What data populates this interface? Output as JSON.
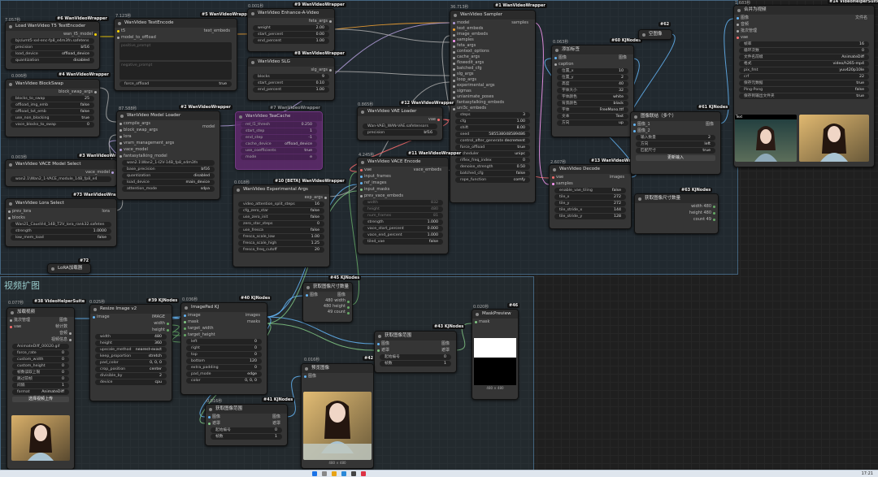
{
  "groups": {
    "main_title": "",
    "expand_title": "视频扩图"
  },
  "colors": {
    "clip": "#ffd500",
    "model": "#b39ddb",
    "image": "#64b5f6",
    "mask": "#81c784",
    "latent": "#ff9cf9",
    "vae": "#ff6e6e",
    "conditioning": "#ffa931"
  },
  "nodes": {
    "t5": {
      "id": "#6 WanVideoWrapper",
      "time": "7.057秒",
      "title": "Load WanVideo T5 TextEncoder",
      "out": "wan_t5_model",
      "widgets": [
        [
          "",
          "bjs/umt5-xxl-enc-fp8_e4m3fn.safetens"
        ],
        [
          "precision",
          "bf16"
        ],
        [
          "load_device",
          "offload_device"
        ],
        [
          "quantization",
          "disabled"
        ]
      ]
    },
    "blockswap": {
      "id": "#4 WanVideoWrapper",
      "time": "0.006秒",
      "title": "WanVideo BlockSwap",
      "out": "block_swap_args",
      "widgets": [
        [
          "blocks_to_swap",
          "25"
        ],
        [
          "offload_img_emb",
          "false"
        ],
        [
          "offload_txt_emb",
          "false"
        ],
        [
          "use_non_blocking",
          "true"
        ],
        [
          "vace_blocks_to_swap",
          "0"
        ]
      ]
    },
    "textencode": {
      "id": "#5 WanVideoWrapper",
      "time": "7.123秒",
      "title": "WanVideo TextEncode",
      "in1": "t5",
      "in2": "model_to_offload",
      "out": "text_embeds",
      "pos": "positive_prompt",
      "neg": "negative_prompt",
      "toggle": [
        "force_offload",
        "true"
      ]
    },
    "model": {
      "id": "#2 WanVideoWrapper",
      "time": "87.588秒",
      "title": "WanVideo Model Loader",
      "out": "model",
      "inputs": [
        "compile_args",
        "block_swap_args",
        "lora",
        "vram_management_args",
        "vace_model",
        "fantasytalking_model"
      ],
      "widgets": [
        [
          "",
          "wan2.1\\Wan2_1-I2V-14B_fp8_e4m3fn"
        ],
        [
          "base_precision",
          "bf16"
        ],
        [
          "quantization",
          "disabled"
        ],
        [
          "load_device",
          "main_device"
        ],
        [
          "attention_mode",
          "sdpa"
        ]
      ]
    },
    "vacemodel": {
      "id": "#3 WanVideoWrapper",
      "time": "0.003秒",
      "title": "WanVideo VACE Model Select",
      "out": "vace_model",
      "widgets": [
        [
          "",
          "wan2.1\\Wan2_1-VACE_module_14B_fp8_e4"
        ]
      ]
    },
    "lora": {
      "id": "#73 WanVideoWrapper",
      "time": "",
      "title": "WanVideo Lora Select",
      "inputs": [
        "prev_lora",
        "blocks"
      ],
      "out": "lora",
      "widgets": [
        [
          "",
          "Wan21_CausVid_14B_T2V_lora_rank32.safeten"
        ],
        [
          "strength",
          "1.0000"
        ],
        [
          "low_mem_load",
          "false"
        ]
      ]
    },
    "enhance": {
      "id": "#9 WanVideoWrapper",
      "time": "0.001秒",
      "title": "WanVideo Enhance-A-Video",
      "out": "feta_args",
      "widgets": [
        [
          "weight",
          "2.00"
        ],
        [
          "start_percent",
          "0.00"
        ],
        [
          "end_percent",
          "1.00"
        ]
      ]
    },
    "slg": {
      "id": "#8 WanVideoWrapper",
      "time": "",
      "title": "WanVideo SLG",
      "out": "slg_args",
      "widgets": [
        [
          "blocks",
          "9"
        ],
        [
          "start_percent",
          "0.10"
        ],
        [
          "end_percent",
          "1.00"
        ]
      ]
    },
    "teacache": {
      "id": "#7 WanVideoWrapper",
      "title": "WanVideo TeaCache",
      "widgets": [
        [
          "rel_l1_thresh",
          "0.250"
        ],
        [
          "start_step",
          "1"
        ],
        [
          "end_step",
          "-1"
        ],
        [
          "cache_device",
          "offload_device"
        ],
        [
          "use_coefficients",
          "true"
        ],
        [
          "mode",
          "e"
        ]
      ]
    },
    "exp": {
      "id": "#10 [BETA] WanVideoWrapper",
      "time": "0.018秒",
      "title": "WanVideo Experimental Args",
      "out": "exp_args",
      "widgets": [
        [
          "video_attention_split_steps",
          "16"
        ],
        [
          "cfg_zero_star",
          "false"
        ],
        [
          "use_zero_init",
          "false"
        ],
        [
          "zero_star_steps",
          "0"
        ],
        [
          "use_fresca",
          "false"
        ],
        [
          "fresca_scale_low",
          "1.00"
        ],
        [
          "fresca_scale_high",
          "1.25"
        ],
        [
          "fresca_freq_cutoff",
          "20"
        ]
      ]
    },
    "sampler": {
      "id": "#1 WanVideoWrapper",
      "time": "36.713秒",
      "title": "WanVideo Sampler",
      "out": "samples",
      "inputs": [
        "model",
        "text_embeds",
        "image_embeds",
        "samples",
        "feta_args",
        "context_options",
        "cache_args",
        "flowedit_args",
        "batched_cfg",
        "slg_args",
        "loop_args",
        "experimental_args",
        "sigmas",
        "unianimate_poses",
        "fantasytalking_embeds",
        "uni3c_embeds"
      ],
      "widgets": [
        [
          "steps",
          "3"
        ],
        [
          "cfg",
          "1.00"
        ],
        [
          "shift",
          "8.00"
        ],
        [
          "seed",
          "585538048589486"
        ],
        [
          "control_after_generate",
          "decrement"
        ],
        [
          "force_offload",
          "true"
        ],
        [
          "scheduler",
          "unipc"
        ],
        [
          "riflex_freq_index",
          "0"
        ],
        [
          "denoise_strength",
          "0.50"
        ],
        [
          "batched_cfg",
          "false"
        ],
        [
          "rope_function",
          "comfy"
        ]
      ]
    },
    "vae": {
      "id": "#12 WanVideoWrapper",
      "time": "0.865秒",
      "title": "WanVideo VAE Loader",
      "out": "vae",
      "widgets": [
        [
          "",
          "Wan-VAE\\_WAN-VAE.safetensors"
        ],
        [
          "precision",
          "bf16"
        ]
      ]
    },
    "vace": {
      "id": "#11 WanVideoWrapper",
      "time": "4.245秒",
      "title": "WanVideo VACE Encode",
      "out": "vace_embeds",
      "inputs": [
        "vae",
        "input_frames",
        "ref_images",
        "input_masks",
        "prev_vace_embeds"
      ],
      "widgets": [
        [
          "width",
          "832"
        ],
        [
          "height",
          "480"
        ],
        [
          "num_frames",
          "81"
        ],
        [
          "strength",
          "1.000"
        ],
        [
          "vace_start_percent",
          "0.000"
        ],
        [
          "vace_end_percent",
          "1.000"
        ],
        [
          "tiled_vae",
          "false"
        ]
      ]
    },
    "decode": {
      "id": "#13 WanVideoWrapper",
      "time": "2.607秒",
      "title": "WanVideo Decode",
      "inputs": [
        "vae",
        "samples"
      ],
      "out": "images",
      "widgets": [
        [
          "enable_vae_tiling",
          "false"
        ],
        [
          "tile_x",
          "272"
        ],
        [
          "tile_y",
          "272"
        ],
        [
          "tile_stride_x",
          "144"
        ],
        [
          "tile_stride_y",
          "128"
        ]
      ]
    },
    "addlabel": {
      "id": "#60 KJNodes",
      "time": "0.063秒",
      "title": "添加标签",
      "inputs": [
        "图像"
      ],
      "in_extra": "caption",
      "out": "图像",
      "widgets": [
        [
          "位置_x",
          "10"
        ],
        [
          "位置_y",
          "2"
        ],
        [
          "高度",
          "40"
        ],
        [
          "字体大小",
          "32"
        ],
        [
          "字体颜色",
          "white"
        ],
        [
          "背景颜色",
          "black"
        ],
        [
          "字体",
          "FreeMono.ttf"
        ],
        [
          "文本",
          "Text"
        ],
        [
          "方向",
          "up"
        ]
      ]
    },
    "emptyimg": {
      "id": "#62",
      "title": "空图像"
    },
    "concat": {
      "id": "#61 KJNodes",
      "title": "图像联结（多个）",
      "inputs": [
        "图像_1",
        "图像_2"
      ],
      "out": "图像",
      "widgets": [
        [
          "输入数量",
          "2"
        ],
        [
          "方向",
          "left"
        ],
        [
          "匹配尺寸",
          "true"
        ]
      ],
      "btn": "更新输入"
    },
    "getsize": {
      "id": "#63 KJNodes",
      "title": "获取图像尺寸数量",
      "outs": [
        [
          "width",
          "480"
        ],
        [
          "height",
          "480"
        ],
        [
          "count",
          "49"
        ]
      ]
    },
    "combine": {
      "id": "#14 VideoHelperSuite",
      "time": "1.683秒",
      "title": "合并为视频",
      "out": "文件名",
      "inputs": [
        "图像",
        "音频",
        "批次管理",
        "vae"
      ],
      "widgets": [
        [
          "帧率",
          "16"
        ],
        [
          "循环次数",
          "0"
        ],
        [
          "文件名前缀",
          "AnimateDiff"
        ],
        [
          "格式",
          "video/h265-mp4"
        ],
        [
          "pix_fmt",
          "yuv420p10le"
        ],
        [
          "crf",
          "22"
        ],
        [
          "保存元数据",
          "true"
        ],
        [
          "Ping-Pong",
          "false"
        ],
        [
          "保存到输出文件夹",
          "true"
        ]
      ],
      "thumb_label": "Text"
    },
    "loadvid": {
      "id": "#38 VideoHelperSuite",
      "time": "0.077秒",
      "title": "加载视频",
      "inputs": [
        "批次管理",
        "vae"
      ],
      "outs": [
        "图像",
        "帧计数",
        "音频",
        "视频信息"
      ],
      "widgets": [
        [
          "",
          "AnimateDiff_00020.gif"
        ],
        [
          "force_rate",
          "0"
        ],
        [
          "custom_width",
          "0"
        ],
        [
          "custom_height",
          "0"
        ],
        [
          "帧数读取上限",
          "0"
        ],
        [
          "跳过前帧",
          "0"
        ],
        [
          "间隔",
          "1"
        ],
        [
          "format",
          "AnimateDiff"
        ]
      ],
      "btn": "选择视频上传"
    },
    "resize": {
      "id": "#39 KJNodes",
      "time": "0.025秒",
      "title": "Resize Image v2",
      "inputs": [
        "image"
      ],
      "outs": [
        "IMAGE",
        "width",
        "height"
      ],
      "widgets": [
        [
          "width",
          "480"
        ],
        [
          "height",
          "360"
        ],
        [
          "upscale_method",
          "nearest-exact"
        ],
        [
          "keep_proportion",
          "stretch"
        ],
        [
          "pad_color",
          "0, 0, 0"
        ],
        [
          "crop_position",
          "center"
        ],
        [
          "divisible_by",
          "2"
        ],
        [
          "device",
          "cpu"
        ]
      ]
    },
    "pad": {
      "id": "#40 KJNodes",
      "time": "0.036秒",
      "title": "ImagePad KJ",
      "inputs": [
        "image",
        "mask",
        "target_width",
        "target_height"
      ],
      "outs": [
        "images",
        "masks"
      ],
      "widgets": [
        [
          "left",
          "0"
        ],
        [
          "right",
          "0"
        ],
        [
          "top",
          "0"
        ],
        [
          "bottom",
          "120"
        ],
        [
          "extra_padding",
          "0"
        ],
        [
          "pad_mode",
          "edge"
        ],
        [
          "color",
          "0, 0, 0"
        ]
      ]
    },
    "getsize2": {
      "id": "#45 KJNodes",
      "title": "获取图像尺寸数量",
      "inputs": [
        "图像"
      ],
      "outs": [
        [
          "图像",
          ""
        ],
        [
          "width",
          "480"
        ],
        [
          "height",
          "480"
        ],
        [
          "count",
          "49"
        ]
      ]
    },
    "range1": {
      "id": "#43 KJNodes",
      "title": "获取图像范围",
      "inputs": [
        "图像",
        "遮罩"
      ],
      "outs": [
        "图像",
        "遮罩"
      ],
      "widgets": [
        [
          "起始编号",
          "0"
        ],
        [
          "帧数",
          "1"
        ]
      ]
    },
    "maskprev": {
      "id": "#46",
      "time": "0.020秒",
      "title": "MaskPreview",
      "inputs": [
        "mask"
      ],
      "caption": "480 × 480"
    },
    "preview": {
      "id": "#42",
      "time": "0.016秒",
      "title": "预览图像",
      "inputs": [
        "图像"
      ],
      "caption": "480 × 480"
    },
    "range2": {
      "id": "#41 KJNodes",
      "time": "0.016秒",
      "title": "获取图像范围",
      "inputs": [
        "图像",
        "遮罩"
      ],
      "outs": [
        "图像",
        "遮罩"
      ],
      "widgets": [
        [
          "起始编号",
          "0"
        ],
        [
          "帧数",
          "1"
        ]
      ]
    },
    "loraacc": {
      "id": "#72",
      "title": "LoRA加载器"
    }
  },
  "taskbar": {
    "time": "17:21"
  }
}
